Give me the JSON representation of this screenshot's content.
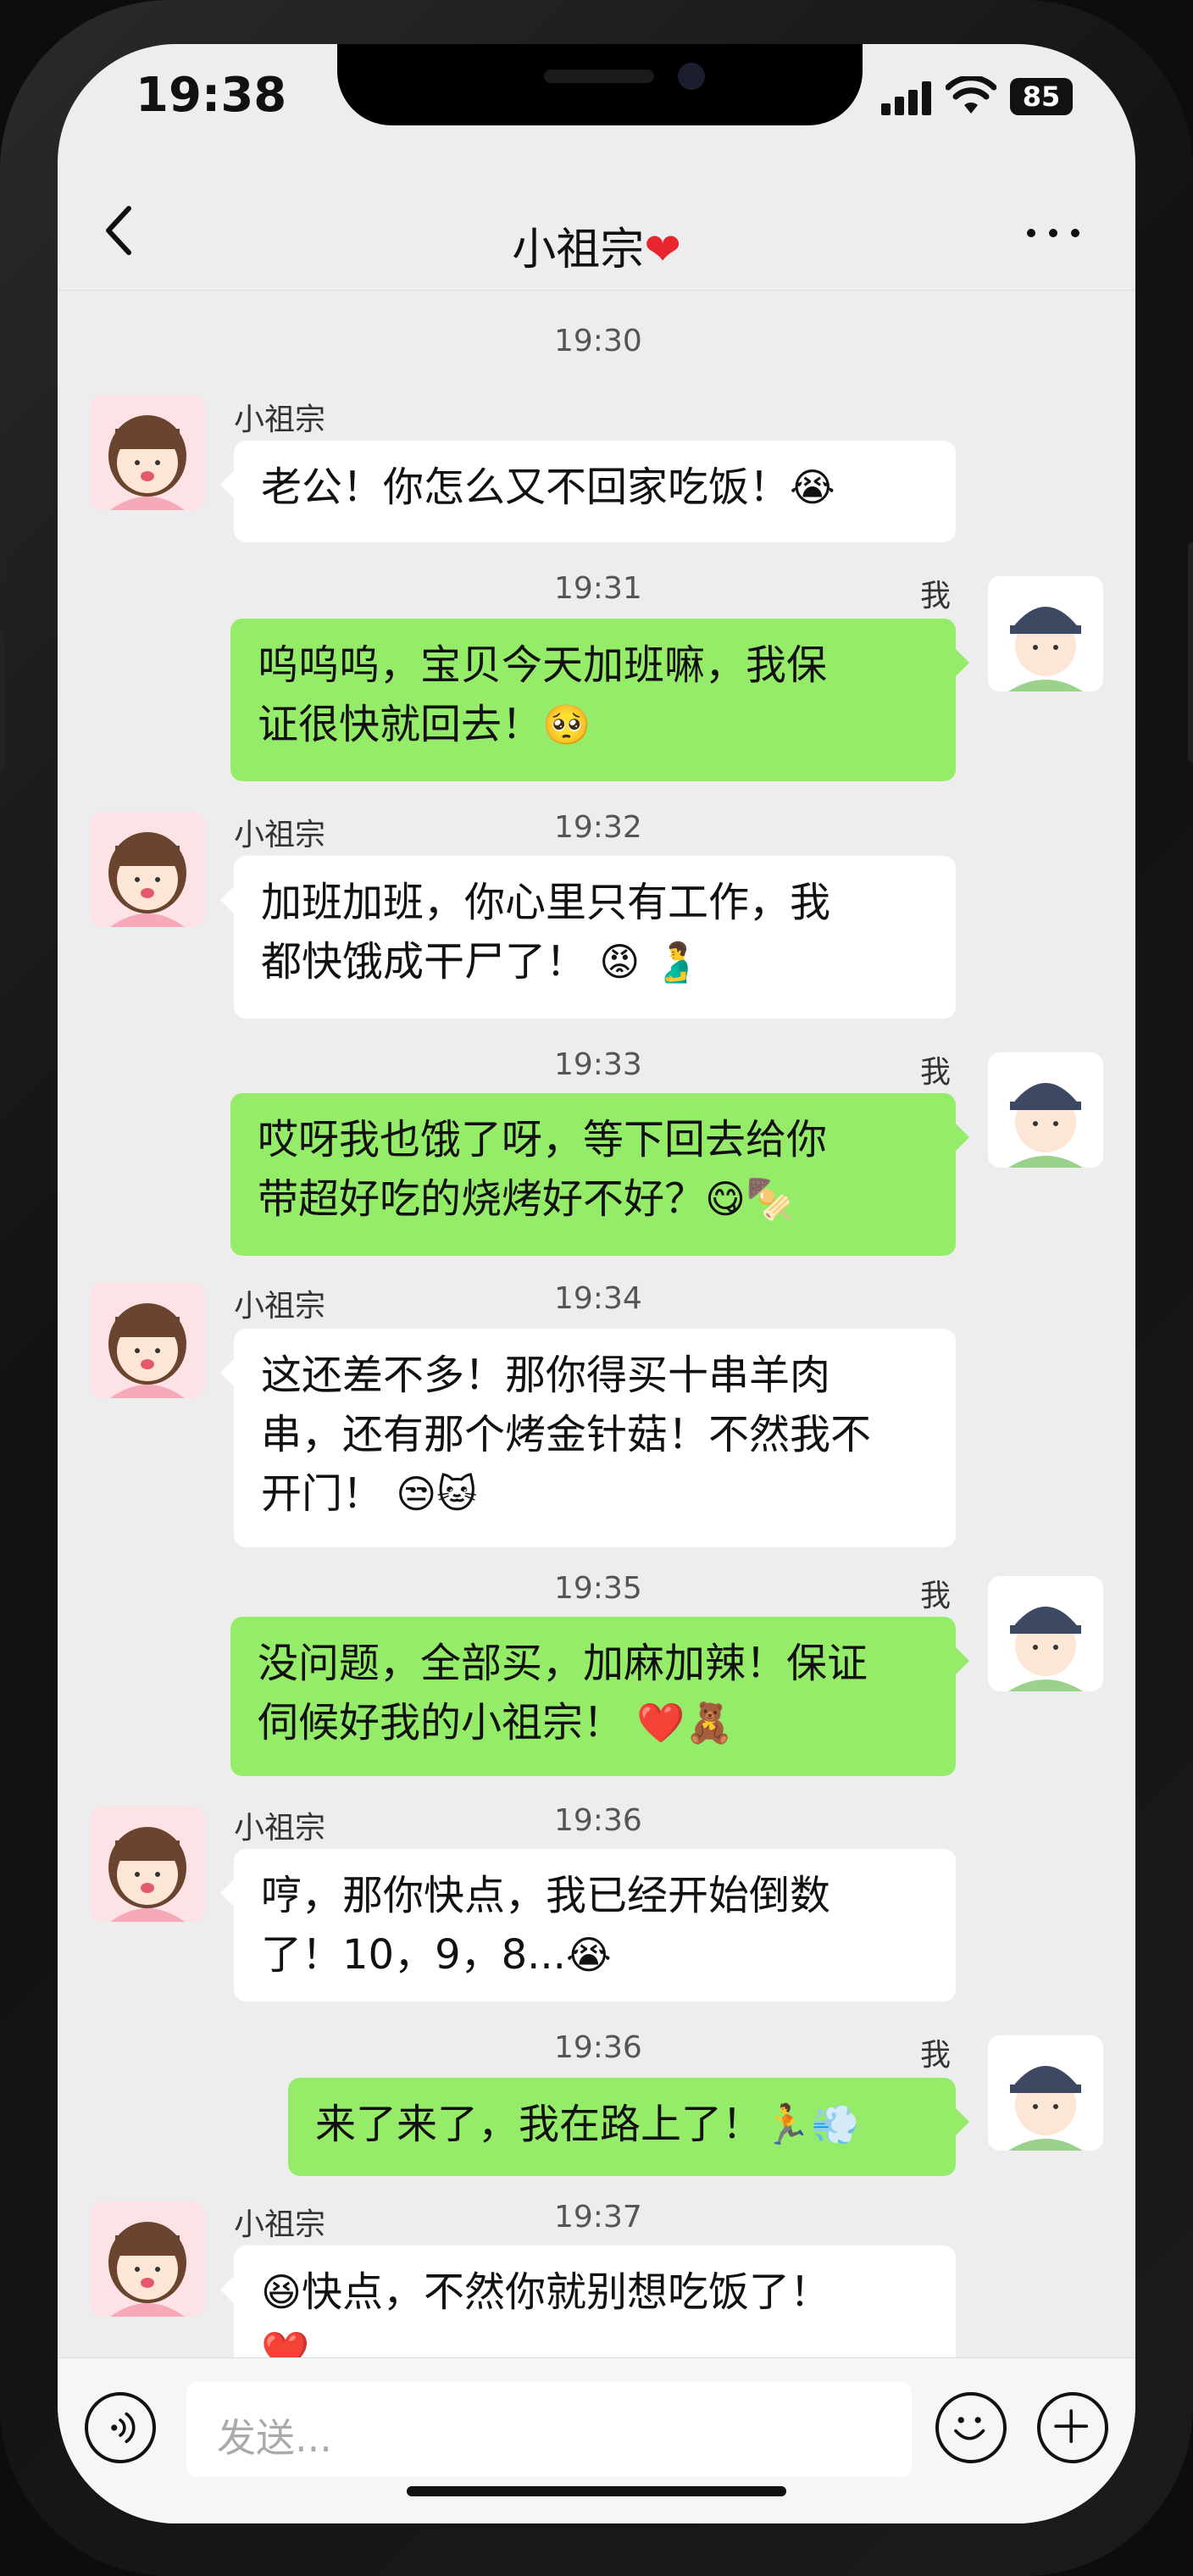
{
  "status": {
    "time": "19:38",
    "battery": "85"
  },
  "header": {
    "title": "小祖宗",
    "title_icon": "red-heart"
  },
  "input": {
    "placeholder": "发送..."
  },
  "messages": [
    {
      "side": "in",
      "sender": "小祖宗",
      "time": "19:30",
      "text": "老公！你怎么又不回家吃饭！",
      "emoji": "😭"
    },
    {
      "side": "out",
      "sender": "我",
      "time": "19:31",
      "lines": [
        "呜呜呜，宝贝今天加班嘛，我保",
        "证很快就回去！"
      ],
      "emoji": "🥺"
    },
    {
      "side": "in",
      "sender": "小祖宗",
      "time": "19:32",
      "lines": [
        "加班加班，你心里只有工作，我",
        "都快饿成干尸了！"
      ],
      "emoji": "😡 🫃"
    },
    {
      "side": "out",
      "sender": "我",
      "time": "19:33",
      "lines": [
        "哎呀我也饿了呀，等下回去给你",
        "带超好吃的烧烤好不好？"
      ],
      "emoji": "😋🍢"
    },
    {
      "side": "in",
      "sender": "小祖宗",
      "time": "19:34",
      "lines": [
        "这还差不多！那你得买十串羊肉",
        "串，还有那个烤金针菇！不然我不",
        "开门！"
      ],
      "emoji": "😒🐱"
    },
    {
      "side": "out",
      "sender": "我",
      "time": "19:35",
      "lines": [
        "没问题，全部买，加麻加辣！保证",
        "伺候好我的小祖宗！"
      ],
      "emoji": "❤️🧸"
    },
    {
      "side": "in",
      "sender": "小祖宗",
      "time": "19:36",
      "lines": [
        "哼，那你快点，我已经开始倒数",
        "了！10，9，8..."
      ],
      "emoji": "😭"
    },
    {
      "side": "out",
      "sender": "我",
      "time": "19:36",
      "text": "来了来了，我在路上了！",
      "emoji": "🏃💨"
    },
    {
      "side": "in",
      "sender": "小祖宗",
      "time": "19:37",
      "text": "快点，不然你就别想吃饭了！",
      "emoji_lead": "😆",
      "emoji": "❤️"
    }
  ]
}
